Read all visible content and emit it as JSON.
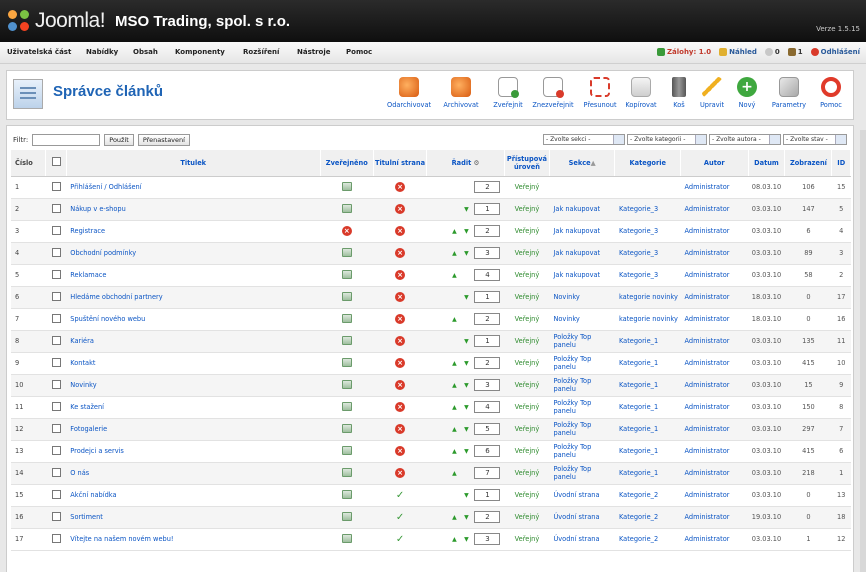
{
  "header": {
    "logo_text": "Joomla!",
    "site_name": "MSO Trading, spol. s r.o.",
    "version": "Verze 1.5.15"
  },
  "menu": {
    "items": [
      "Uživatelská část",
      "Nabídky",
      "Obsah",
      "Komponenty",
      "Rozšíření",
      "Nástroje",
      "Pomoc"
    ]
  },
  "status": {
    "enabled": "Zálohy: 1.0",
    "preview": "Náhled",
    "messages": "0",
    "users": "1",
    "logout": "Odhlášení"
  },
  "toolbar": {
    "title": "Správce článků",
    "buttons": [
      "Odarchivovat",
      "Archivovat",
      "Zveřejnit",
      "Znezveřejnit",
      "Přesunout",
      "Kopírovat",
      "Koš",
      "Upravit",
      "Nový",
      "Parametry",
      "Pomoc"
    ]
  },
  "filter": {
    "label": "Filtr:",
    "value": "",
    "apply": "Použít",
    "reset": "Přenastavení",
    "selects": [
      "- Zvolte sekci -",
      "- Zvolte kategorii -",
      "- Zvolte autora -",
      "- Zvolte stav -"
    ]
  },
  "table": {
    "headers": {
      "num": "Číslo",
      "title": "Titulek",
      "published": "Zveřejněno",
      "front": "Titulní strana",
      "order": "Řadit",
      "access": "Přístupová úroveň",
      "section": "Sekce",
      "category": "Kategorie",
      "author": "Autor",
      "date": "Datum",
      "hits": "Zobrazení",
      "id": "ID"
    },
    "rows": [
      {
        "num": "1",
        "title": "Přihlášení / Odhlášení",
        "pub": "yes",
        "front": "no",
        "up": false,
        "down": false,
        "order": "2",
        "access": "Veřejný",
        "section": "",
        "category": "",
        "author": "Administrator",
        "date": "08.03.10",
        "hits": "106",
        "id": "15"
      },
      {
        "num": "2",
        "title": "Nákup v e-shopu",
        "pub": "yes",
        "front": "no",
        "up": false,
        "down": true,
        "order": "1",
        "access": "Veřejný",
        "section": "Jak nakupovat",
        "category": "Kategorie_3",
        "author": "Administrator",
        "date": "03.03.10",
        "hits": "147",
        "id": "5"
      },
      {
        "num": "3",
        "title": "Registrace",
        "pub": "no",
        "front": "no",
        "up": true,
        "down": true,
        "order": "2",
        "access": "Veřejný",
        "section": "Jak nakupovat",
        "category": "Kategorie_3",
        "author": "Administrator",
        "date": "03.03.10",
        "hits": "6",
        "id": "4"
      },
      {
        "num": "4",
        "title": "Obchodní podmínky",
        "pub": "yes",
        "front": "no",
        "up": true,
        "down": true,
        "order": "3",
        "access": "Veřejný",
        "section": "Jak nakupovat",
        "category": "Kategorie_3",
        "author": "Administrator",
        "date": "03.03.10",
        "hits": "89",
        "id": "3"
      },
      {
        "num": "5",
        "title": "Reklamace",
        "pub": "yes",
        "front": "no",
        "up": true,
        "down": false,
        "order": "4",
        "access": "Veřejný",
        "section": "Jak nakupovat",
        "category": "Kategorie_3",
        "author": "Administrator",
        "date": "03.03.10",
        "hits": "58",
        "id": "2"
      },
      {
        "num": "6",
        "title": "Hledáme obchodní partnery",
        "pub": "yes",
        "front": "no",
        "up": false,
        "down": true,
        "order": "1",
        "access": "Veřejný",
        "section": "Novinky",
        "category": "kategorie novinky",
        "author": "Administrator",
        "date": "18.03.10",
        "hits": "0",
        "id": "17"
      },
      {
        "num": "7",
        "title": "Spuštění nového webu",
        "pub": "yes",
        "front": "no",
        "up": true,
        "down": false,
        "order": "2",
        "access": "Veřejný",
        "section": "Novinky",
        "category": "kategorie novinky",
        "author": "Administrator",
        "date": "18.03.10",
        "hits": "0",
        "id": "16"
      },
      {
        "num": "8",
        "title": "Kariéra",
        "pub": "yes",
        "front": "no",
        "up": false,
        "down": true,
        "order": "1",
        "access": "Veřejný",
        "section": "Položky Top panelu",
        "category": "Kategorie_1",
        "author": "Administrator",
        "date": "03.03.10",
        "hits": "135",
        "id": "11"
      },
      {
        "num": "9",
        "title": "Kontakt",
        "pub": "yes",
        "front": "no",
        "up": true,
        "down": true,
        "order": "2",
        "access": "Veřejný",
        "section": "Položky Top panelu",
        "category": "Kategorie_1",
        "author": "Administrator",
        "date": "03.03.10",
        "hits": "415",
        "id": "10"
      },
      {
        "num": "10",
        "title": "Novinky",
        "pub": "yes",
        "front": "no",
        "up": true,
        "down": true,
        "order": "3",
        "access": "Veřejný",
        "section": "Položky Top panelu",
        "category": "Kategorie_1",
        "author": "Administrator",
        "date": "03.03.10",
        "hits": "15",
        "id": "9"
      },
      {
        "num": "11",
        "title": "Ke stažení",
        "pub": "yes",
        "front": "no",
        "up": true,
        "down": true,
        "order": "4",
        "access": "Veřejný",
        "section": "Položky Top panelu",
        "category": "Kategorie_1",
        "author": "Administrator",
        "date": "03.03.10",
        "hits": "150",
        "id": "8"
      },
      {
        "num": "12",
        "title": "Fotogalerie",
        "pub": "yes",
        "front": "no",
        "up": true,
        "down": true,
        "order": "5",
        "access": "Veřejný",
        "section": "Položky Top panelu",
        "category": "Kategorie_1",
        "author": "Administrator",
        "date": "03.03.10",
        "hits": "297",
        "id": "7"
      },
      {
        "num": "13",
        "title": "Prodejci a servis",
        "pub": "yes",
        "front": "no",
        "up": true,
        "down": true,
        "order": "6",
        "access": "Veřejný",
        "section": "Položky Top panelu",
        "category": "Kategorie_1",
        "author": "Administrator",
        "date": "03.03.10",
        "hits": "415",
        "id": "6"
      },
      {
        "num": "14",
        "title": "O nás",
        "pub": "yes",
        "front": "no",
        "up": true,
        "down": false,
        "order": "7",
        "access": "Veřejný",
        "section": "Položky Top panelu",
        "category": "Kategorie_1",
        "author": "Administrator",
        "date": "03.03.10",
        "hits": "218",
        "id": "1"
      },
      {
        "num": "15",
        "title": "Akční nabídka",
        "pub": "yes",
        "front": "yes",
        "up": false,
        "down": true,
        "order": "1",
        "access": "Veřejný",
        "section": "Úvodní strana",
        "category": "Kategorie_2",
        "author": "Administrator",
        "date": "03.03.10",
        "hits": "0",
        "id": "13"
      },
      {
        "num": "16",
        "title": "Sortiment",
        "pub": "yes",
        "front": "yes",
        "up": true,
        "down": true,
        "order": "2",
        "access": "Veřejný",
        "section": "Úvodní strana",
        "category": "Kategorie_2",
        "author": "Administrator",
        "date": "19.03.10",
        "hits": "0",
        "id": "18"
      },
      {
        "num": "17",
        "title": "Vítejte na našem novém webu!",
        "pub": "yes",
        "front": "yes",
        "up": true,
        "down": true,
        "order": "3",
        "access": "Veřejný",
        "section": "Úvodní strana",
        "category": "Kategorie_2",
        "author": "Administrator",
        "date": "03.03.10",
        "hits": "1",
        "id": "12"
      }
    ]
  },
  "colors": {
    "link": "#0b55c4",
    "access_green": "#2c8a2c",
    "header_bg": "#1a1a1a"
  },
  "icons": {
    "toolbar": [
      "unarchive-icon",
      "archive-icon",
      "publish-icon",
      "unpublish-icon",
      "move-icon",
      "copy-icon",
      "trash-icon",
      "edit-icon",
      "new-icon",
      "parameters-icon",
      "help-icon"
    ]
  }
}
